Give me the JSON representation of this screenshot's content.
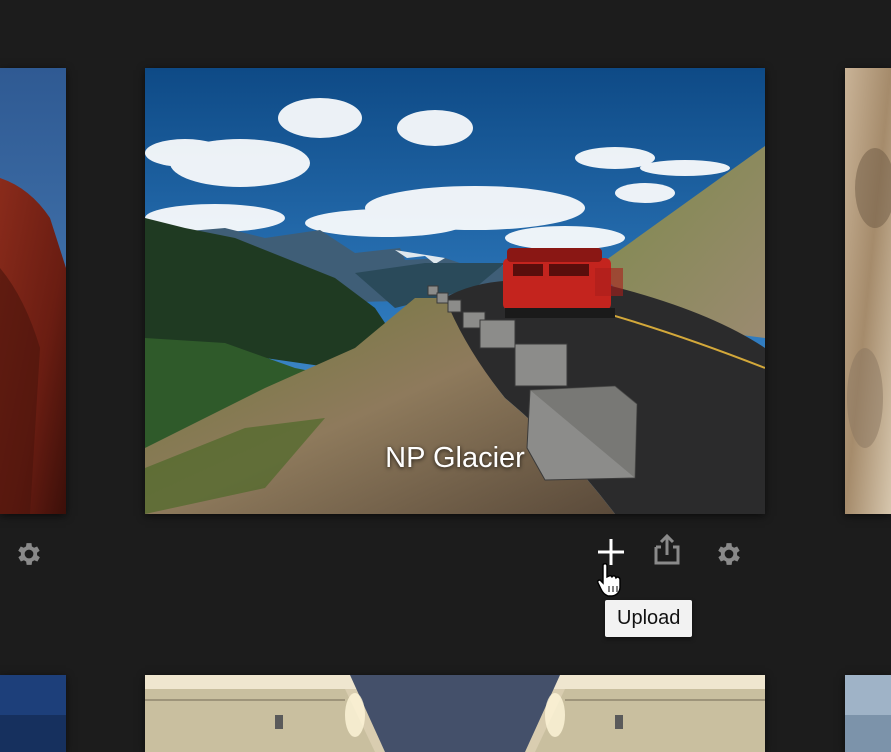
{
  "album": {
    "title": "NP Glacier"
  },
  "actions": {
    "upload_tooltip": "Upload",
    "add_icon": "plus-icon",
    "share_icon": "share-icon",
    "settings_icon": "gear-icon"
  },
  "colors": {
    "background": "#1c1c1c",
    "icon": "#8a8a8a",
    "icon_active": "#ffffff",
    "tooltip_bg": "#f2f2f2"
  }
}
